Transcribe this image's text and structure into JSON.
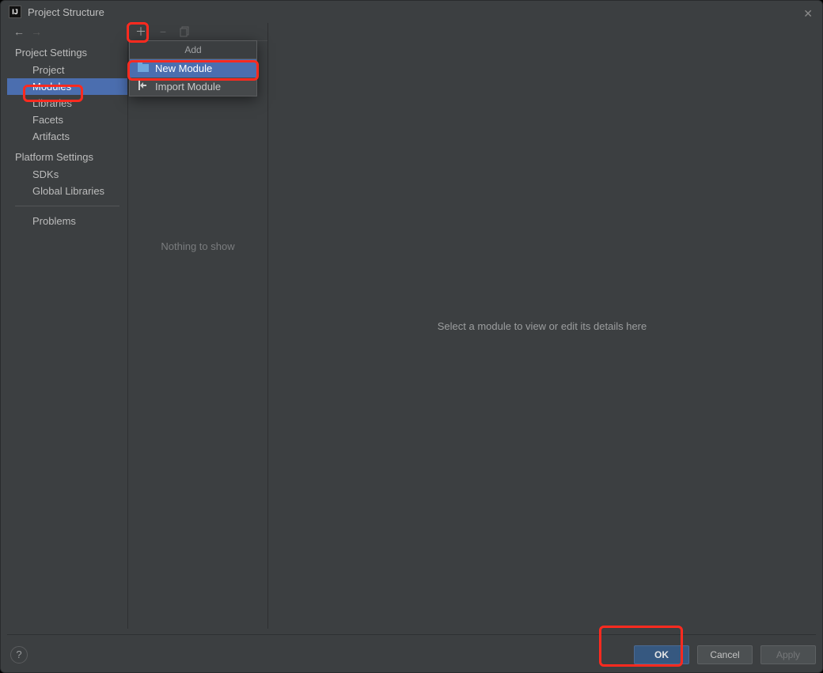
{
  "window": {
    "title": "Project Structure"
  },
  "sidebar": {
    "section1": "Project Settings",
    "items1": {
      "project": "Project",
      "modules": "Modules",
      "libraries": "Libraries",
      "facets": "Facets",
      "artifacts": "Artifacts"
    },
    "section2": "Platform Settings",
    "items2": {
      "sdks": "SDKs",
      "global_libraries": "Global Libraries"
    },
    "problems": "Problems"
  },
  "list_panel": {
    "empty_text": "Nothing to show"
  },
  "detail": {
    "placeholder": "Select a module to view or edit its details here"
  },
  "popup": {
    "header": "Add",
    "new_module": "New Module",
    "import_module": "Import Module"
  },
  "buttons": {
    "ok": "OK",
    "cancel": "Cancel",
    "apply": "Apply"
  }
}
